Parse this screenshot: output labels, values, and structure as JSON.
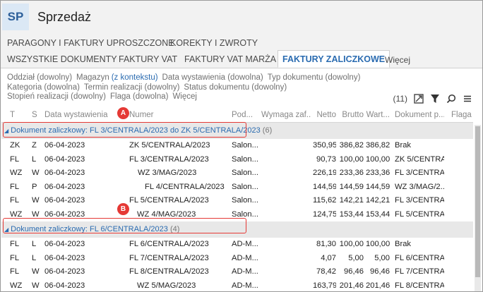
{
  "app": {
    "logo": "SP",
    "title": "Sprzedaż"
  },
  "tabs_row1": [
    "PARAGONY I FAKTURY UPROSZCZONE",
    "KOREKTY I ZWROTY"
  ],
  "tabs_row2": [
    "WSZYSTKIE DOKUMENTY",
    "FAKTURY VAT",
    "FAKTURY VAT MARŻA",
    "FAKTURY ZALICZKOWE"
  ],
  "tabs_more": "Więcej",
  "filters": {
    "oddzial": "Oddział (dowolny)",
    "magazyn": "Magazyn",
    "magazyn_ctx": "(z kontekstu)",
    "data_wystawienia": "Data wystawienia (dowolna)",
    "typ_dokumentu": "Typ dokumentu (dowolny)",
    "kategoria": "Kategoria (dowolna)",
    "termin_realizacji": "Termin realizacji (dowolny)",
    "status_dokumentu": "Status dokumentu (dowolny)",
    "stopien_realizacji": "Stopień realizacji (dowolny)",
    "flaga": "Flaga (dowolna)",
    "wiecej": "Więcej"
  },
  "toolbar": {
    "count": "(11)",
    "icons": [
      "export-icon",
      "filter-icon",
      "search-icon",
      "menu-icon"
    ]
  },
  "columns": [
    "T",
    "S",
    "Data wystawienia",
    "Numer",
    "Pod...",
    "Wymaga zaf...",
    "Netto",
    "Brutto",
    "Wart...",
    "Dokument p...",
    "Flaga"
  ],
  "groups": [
    {
      "label": "Dokument zaliczkowy: FL 3/CENTRALA/2023 do ZK 5/CENTRALA/2023",
      "count": "(6)",
      "rows": [
        [
          "ZK",
          "Z",
          "06-04-2023",
          "ZK 5/CENTRALA/2023",
          "Salon...",
          "",
          "350,95",
          "386,82",
          "386,82",
          "Brak",
          ""
        ],
        [
          "FL",
          "L",
          "06-04-2023",
          "FL 3/CENTRALA/2023",
          "Salon...",
          "",
          "90,73",
          "100,00",
          "100,00",
          "ZK 5/CENTRA...",
          ""
        ],
        [
          "WZ",
          "W",
          "06-04-2023",
          "WZ 3/MAG/2023",
          "Salon...",
          "",
          "226,19",
          "233,36",
          "233,36",
          "FL 3/CENTRA...",
          ""
        ],
        [
          "FL",
          "P",
          "06-04-2023",
          "FL 4/CENTRALA/2023",
          "Salon...",
          "",
          "144,59",
          "144,59",
          "144,59",
          "WZ 3/MAG/2...",
          ""
        ],
        [
          "FL",
          "W",
          "06-04-2023",
          "FL 5/CENTRALA/2023",
          "Salon...",
          "",
          "115,62",
          "142,21",
          "142,21",
          "FL 3/CENTRA...",
          ""
        ],
        [
          "WZ",
          "W",
          "06-04-2023",
          "WZ 4/MAG/2023",
          "Salon...",
          "",
          "124,75",
          "153,44",
          "153,44",
          "FL 5/CENTRA...",
          ""
        ]
      ]
    },
    {
      "label": "Dokument zaliczkowy: FL 6/CENTRALA/2023",
      "count": "(4)",
      "rows": [
        [
          "FL",
          "L",
          "06-04-2023",
          "FL 6/CENTRALA/2023",
          "AD-M...",
          "",
          "81,30",
          "100,00",
          "100,00",
          "Brak",
          ""
        ],
        [
          "FL",
          "L",
          "06-04-2023",
          "FL 7/CENTRALA/2023",
          "AD-M...",
          "",
          "4,07",
          "5,00",
          "5,00",
          "FL 6/CENTRA...",
          ""
        ],
        [
          "FL",
          "W",
          "06-04-2023",
          "FL 8/CENTRALA/2023",
          "AD-M...",
          "",
          "78,42",
          "96,46",
          "96,46",
          "FL 7/CENTRA...",
          ""
        ],
        [
          "WZ",
          "W",
          "06-04-2023",
          "WZ 5/MAG/2023",
          "AD-M...",
          "",
          "163,79",
          "201,46",
          "201,46",
          "FL 8/CENTRA...",
          ""
        ]
      ]
    }
  ],
  "callouts": [
    "A",
    "B"
  ],
  "colors": {
    "accent": "#2a6bb0",
    "callout": "#e53935",
    "group_bg": "#e8e8e8"
  }
}
